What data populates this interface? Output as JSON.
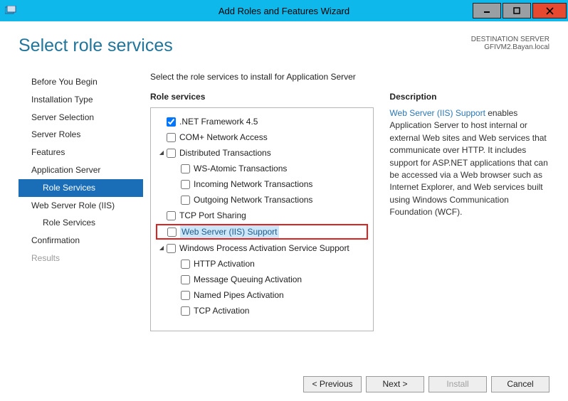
{
  "titlebar": {
    "title": "Add Roles and Features Wizard"
  },
  "page": {
    "title": "Select role services",
    "destination_label": "DESTINATION SERVER",
    "destination_value": "GFIVM2.Bayan.local",
    "instruction": "Select the role services to install for Application Server"
  },
  "nav": [
    {
      "label": "Before You Begin",
      "indent": 0
    },
    {
      "label": "Installation Type",
      "indent": 0
    },
    {
      "label": "Server Selection",
      "indent": 0
    },
    {
      "label": "Server Roles",
      "indent": 0
    },
    {
      "label": "Features",
      "indent": 0
    },
    {
      "label": "Application Server",
      "indent": 0
    },
    {
      "label": "Role Services",
      "indent": 1,
      "selected": true
    },
    {
      "label": "Web Server Role (IIS)",
      "indent": 0
    },
    {
      "label": "Role Services",
      "indent": 1
    },
    {
      "label": "Confirmation",
      "indent": 0
    },
    {
      "label": "Results",
      "indent": 0,
      "muted": true
    }
  ],
  "roles": {
    "heading": "Role services",
    "items": [
      {
        "label": ".NET Framework 4.5",
        "indent": 1,
        "checked": true
      },
      {
        "label": "COM+ Network Access",
        "indent": 1
      },
      {
        "label": "Distributed Transactions",
        "indent": 1,
        "expander": "▲"
      },
      {
        "label": "WS-Atomic Transactions",
        "indent": 2
      },
      {
        "label": "Incoming Network Transactions",
        "indent": 2
      },
      {
        "label": "Outgoing Network Transactions",
        "indent": 2
      },
      {
        "label": "TCP Port Sharing",
        "indent": 1
      },
      {
        "label": "Web Server (IIS) Support",
        "indent": 1,
        "highlight": true
      },
      {
        "label": "Windows Process Activation Service Support",
        "indent": 1,
        "expander": "▲"
      },
      {
        "label": "HTTP Activation",
        "indent": 2
      },
      {
        "label": "Message Queuing Activation",
        "indent": 2
      },
      {
        "label": "Named Pipes Activation",
        "indent": 2
      },
      {
        "label": "TCP Activation",
        "indent": 2
      }
    ]
  },
  "description": {
    "heading": "Description",
    "term": "Web Server (IIS) Support",
    "body": " enables Application Server to host internal or external Web sites and Web services that communicate over HTTP. It includes support for ASP.NET applications that can be accessed via a Web browser such as Internet Explorer, and Web services built using Windows Communication Foundation (WCF)."
  },
  "footer": {
    "previous": "< Previous",
    "next": "Next >",
    "install": "Install",
    "cancel": "Cancel"
  }
}
